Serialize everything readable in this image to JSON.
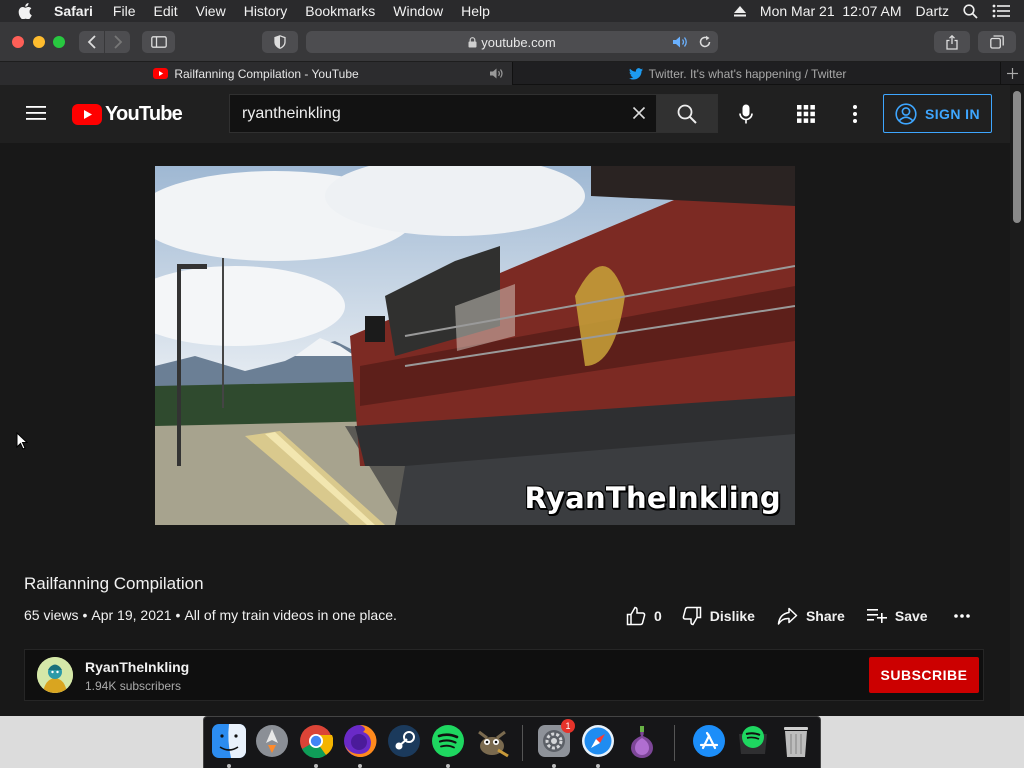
{
  "menubar": {
    "items": [
      "Safari",
      "File",
      "Edit",
      "View",
      "History",
      "Bookmarks",
      "Window",
      "Help"
    ],
    "datetime": "Mon Mar 21  12:07 AM",
    "user": "Dartz"
  },
  "toolbar": {
    "url": "youtube.com"
  },
  "tabs": [
    {
      "title": "Railfanning Compilation - YouTube"
    },
    {
      "title": "Twitter. It's what's happening / Twitter"
    }
  ],
  "youtube": {
    "logo_text": "YouTube",
    "search_value": "ryantheinkling",
    "sign_in_label": "SIGN IN",
    "colors": {
      "accent_blue": "#3ea6ff",
      "brand_red": "#ff0000",
      "subscribe_red": "#cc0000"
    }
  },
  "video": {
    "watermark": "RyanTheInkling",
    "title": "Railfanning Compilation",
    "views": "65 views",
    "date": "Apr 19, 2021",
    "description": "All of my train videos in one place.",
    "likes": "0",
    "dislike_label": "Dislike",
    "share_label": "Share",
    "save_label": "Save"
  },
  "channel": {
    "name": "RyanTheInkling",
    "subscribers": "1.94K subscribers",
    "subscribe_label": "SUBSCRIBE"
  },
  "dock": {
    "apps": [
      "finder-icon",
      "launchpad-icon",
      "chrome-icon",
      "firefox-icon",
      "steam-icon",
      "spotify-icon",
      "gimp-icon",
      "system-preferences-icon",
      "safari-icon",
      "tor-icon",
      "app-store-icon",
      "spotify-downloads-icon",
      "trash-icon"
    ],
    "system_preferences_badge": "1"
  }
}
